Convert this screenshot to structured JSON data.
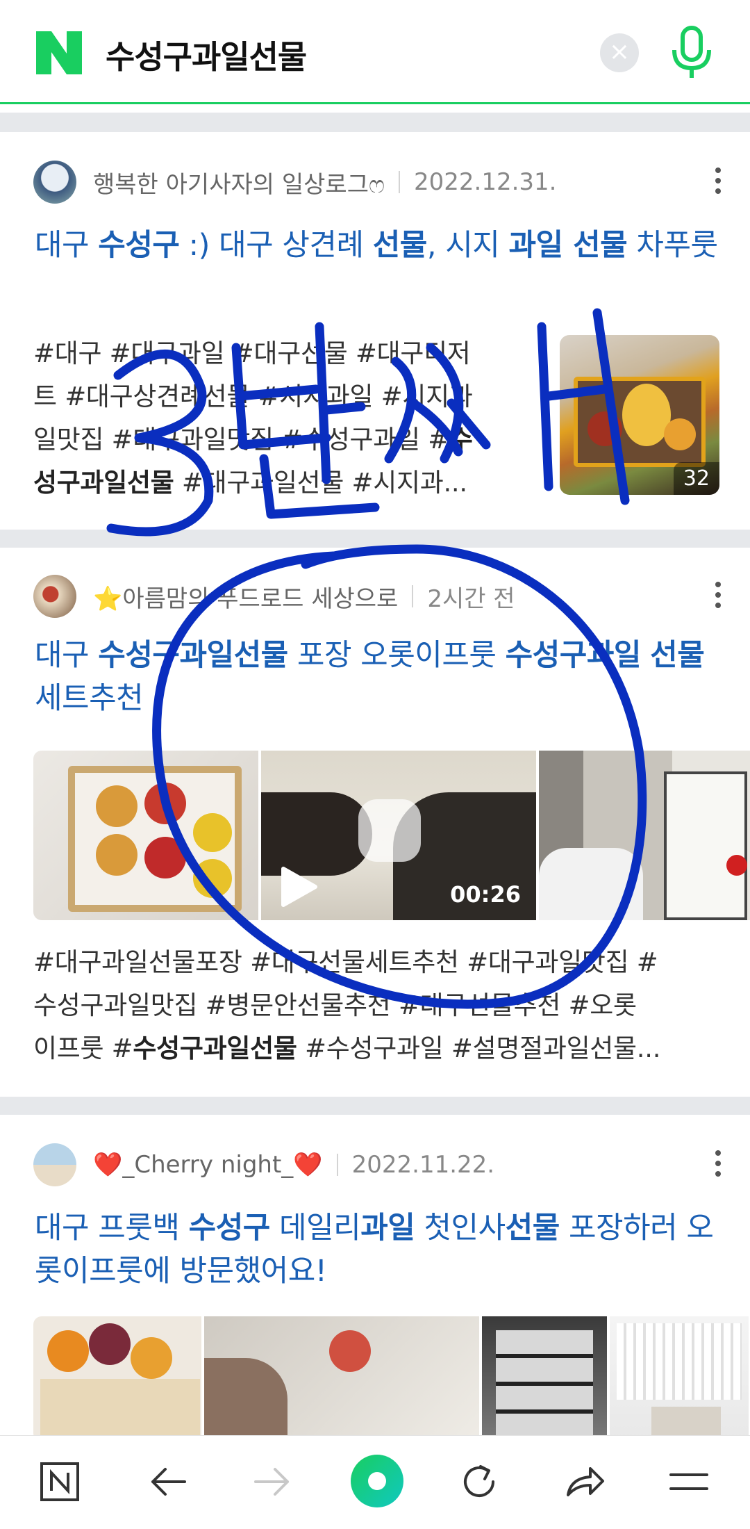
{
  "search": {
    "query": "수성구과일선물",
    "clear_icon": "close-icon",
    "mic_icon": "microphone-icon"
  },
  "posts": [
    {
      "author": "행복한 아기사자의 일상로그ෆ",
      "date": "2022.12.31.",
      "title": [
        {
          "t": "대구 ",
          "b": false
        },
        {
          "t": "수성구",
          "b": true
        },
        {
          "t": " :) 대구 상견례 ",
          "b": false
        },
        {
          "t": "선물",
          "b": true
        },
        {
          "t": ", 시지 ",
          "b": false
        },
        {
          "t": "과일 선물",
          "b": true
        },
        {
          "t": " 차푸룻",
          "b": false
        }
      ],
      "desc_lines": [
        [
          {
            "t": "#대구 #대구과일 #대구선물 #대구디저",
            "b": false
          }
        ],
        [
          {
            "t": "트 #대구상견례선물 #시지과일 #시지과",
            "b": false
          }
        ],
        [
          {
            "t": "일맛집 #대구과일맛집 #수성구과일 #",
            "b": false
          },
          {
            "t": "수",
            "b": true
          }
        ],
        [
          {
            "t": "성구과일선물",
            "b": true
          },
          {
            "t": " #대구과일선물 #시지과...",
            "b": false
          }
        ]
      ],
      "image_count": "32"
    },
    {
      "author": "⭐아름맘의 푸드로드 세상으로",
      "date": "2시간 전",
      "title": [
        {
          "t": "대구 ",
          "b": false
        },
        {
          "t": "수성구과일선물",
          "b": true
        },
        {
          "t": " 포장 오롯이프룻 ",
          "b": false
        },
        {
          "t": "수성구과일",
          "b": true
        },
        {
          "t": " ",
          "b": false
        },
        {
          "t": "선물",
          "b": true
        },
        {
          "t": "세트추천",
          "b": false
        }
      ],
      "video_duration": "00:26",
      "desc_lines": [
        [
          {
            "t": "#대구과일선물포장 #대구선물세트추천 #대구과일맛집 #",
            "b": false
          }
        ],
        [
          {
            "t": "수성구과일맛집 #병문안선물추천 #대구선물추천 #오롯",
            "b": false
          }
        ],
        [
          {
            "t": "이프룻 #",
            "b": false
          },
          {
            "t": "수성구과일선물",
            "b": true
          },
          {
            "t": " #수성구과일 #설명절과일선물...",
            "b": false
          }
        ]
      ]
    },
    {
      "author": "❤️_Cherry night_❤️",
      "date": "2022.11.22.",
      "title": [
        {
          "t": "대구 프룻백 ",
          "b": false
        },
        {
          "t": "수성구",
          "b": true
        },
        {
          "t": " 데일리",
          "b": false
        },
        {
          "t": "과일",
          "b": true
        },
        {
          "t": " 첫인사",
          "b": false
        },
        {
          "t": "선물",
          "b": true
        },
        {
          "t": " 포장하러 오롯이프룻에 방문했어요!",
          "b": false
        }
      ]
    }
  ],
  "annotation": {
    "text": "3번째",
    "color": "#0a2ebf"
  },
  "bottom_nav": [
    "naver-home-icon",
    "back-arrow-icon",
    "forward-arrow-icon",
    "green-dot-icon",
    "refresh-icon",
    "share-icon",
    "menu-icon"
  ],
  "colors": {
    "brand_green": "#19ce60",
    "title_blue": "#1a5fb4",
    "annotation_blue": "#0a2ebf"
  }
}
